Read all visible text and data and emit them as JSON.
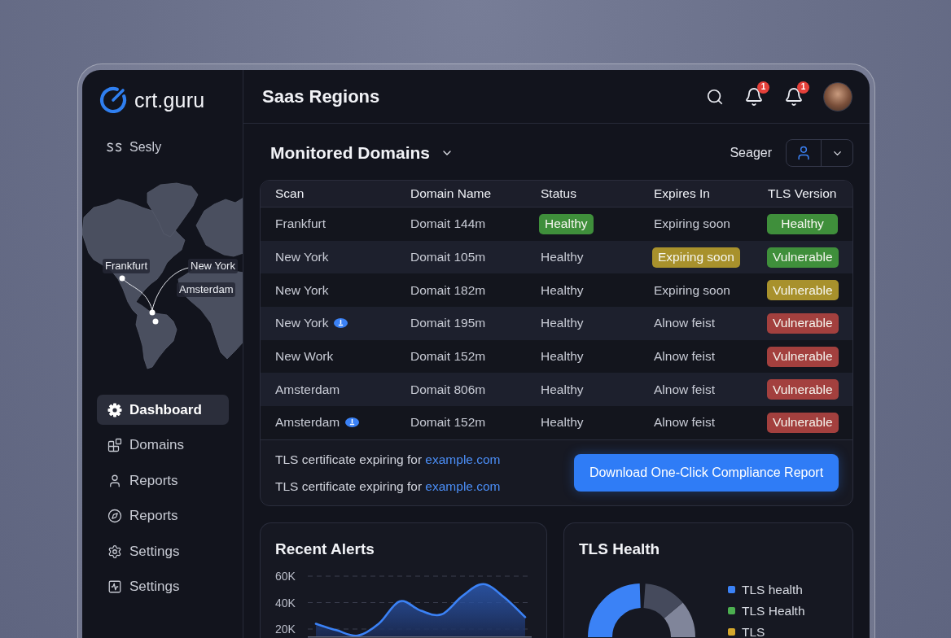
{
  "sidebar": {
    "logo": "crt.guru",
    "workspace": "Sesly",
    "map_labels": [
      "Frankfurt",
      "New York",
      "Amsterdam"
    ],
    "nav": [
      {
        "label": "Dashboard",
        "selected": true
      },
      {
        "label": "Domains",
        "selected": false
      },
      {
        "label": "Reports",
        "selected": false
      },
      {
        "label": "Reports",
        "selected": false
      },
      {
        "label": "Settings",
        "selected": false
      },
      {
        "label": "Settings",
        "selected": false
      }
    ]
  },
  "header": {
    "title": "Saas Regions",
    "notifications": [
      {
        "count": "1"
      },
      {
        "count": "1"
      }
    ]
  },
  "domains": {
    "title": "Monitored Domains",
    "owner": "Seager",
    "columns": [
      "Scan",
      "Domain Name",
      "Status",
      "Expires In",
      "TLS Version"
    ],
    "rows": [
      {
        "scan": "Frankfurt",
        "flagged": false,
        "domain": "Domait 144m",
        "status": {
          "kind": "badge",
          "label": "Healthy",
          "color": "#3f8f3b"
        },
        "expires": {
          "kind": "text",
          "label": "Expiring soon"
        },
        "tls": {
          "kind": "badge",
          "label": "Healthy",
          "color": "#3f8f3b"
        }
      },
      {
        "scan": "New York",
        "flagged": false,
        "domain": "Domait 105m",
        "status": {
          "kind": "text",
          "label": "Healthy"
        },
        "expires": {
          "kind": "badge",
          "label": "Expiring soon",
          "color": "#a8912c"
        },
        "tls": {
          "kind": "badge",
          "label": "Vulnerable",
          "color": "#3f8f3b"
        }
      },
      {
        "scan": "New York",
        "flagged": false,
        "domain": "Domait 182m",
        "status": {
          "kind": "text",
          "label": "Healthy"
        },
        "expires": {
          "kind": "text",
          "label": "Expiring soon"
        },
        "tls": {
          "kind": "badge",
          "label": "Vulnerable",
          "color": "#a8912c"
        }
      },
      {
        "scan": "New York",
        "flagged": true,
        "domain": "Domait 195m",
        "status": {
          "kind": "text",
          "label": "Healthy"
        },
        "expires": {
          "kind": "text",
          "label": "Alnow feist"
        },
        "tls": {
          "kind": "badge",
          "label": "Vulnerable",
          "color": "#a3403e"
        }
      },
      {
        "scan": "New Work",
        "flagged": false,
        "domain": "Domait 152m",
        "status": {
          "kind": "text",
          "label": "Healthy"
        },
        "expires": {
          "kind": "text",
          "label": "Alnow feist"
        },
        "tls": {
          "kind": "badge",
          "label": "Vulnerable",
          "color": "#a3403e"
        }
      },
      {
        "scan": "Amsterdam",
        "flagged": false,
        "domain": "Domait 806m",
        "status": {
          "kind": "text",
          "label": "Healthy"
        },
        "expires": {
          "kind": "text",
          "label": "Alnow feist"
        },
        "tls": {
          "kind": "badge",
          "label": "Vulnerable",
          "color": "#a3403e"
        }
      },
      {
        "scan": "Amsterdam",
        "flagged": true,
        "domain": "Domait 152m",
        "status": {
          "kind": "text",
          "label": "Healthy"
        },
        "expires": {
          "kind": "text",
          "label": "Alnow feist"
        },
        "tls": {
          "kind": "badge",
          "label": "Vulnerable",
          "color": "#a3403e"
        }
      }
    ],
    "alerts": [
      {
        "text": "TLS certificate expiring for",
        "link": "example.com"
      },
      {
        "text": "TLS certificate expiring for",
        "link": "example.com"
      }
    ],
    "download_button": "Download One-Click Compliance Report"
  },
  "recent_alerts": {
    "title": "Recent Alerts",
    "chart_data": {
      "type": "area",
      "values": [
        24000,
        19000,
        15000,
        24000,
        41000,
        34000,
        31000,
        45000,
        54000,
        44000,
        29000
      ],
      "ylim": [
        14000,
        60000
      ],
      "yticks": [
        {
          "value": 20000,
          "label": "20K"
        },
        {
          "value": 40000,
          "label": "40K"
        },
        {
          "value": 60000,
          "label": "60K"
        }
      ],
      "grid": true
    }
  },
  "tls_health": {
    "title": "TLS Health",
    "legend": [
      {
        "label": "TLS health",
        "color": "#3b82f6"
      },
      {
        "label": "TLS Health",
        "color": "#4caf50"
      },
      {
        "label": "TLS",
        "color": "#d4a72c"
      }
    ]
  }
}
